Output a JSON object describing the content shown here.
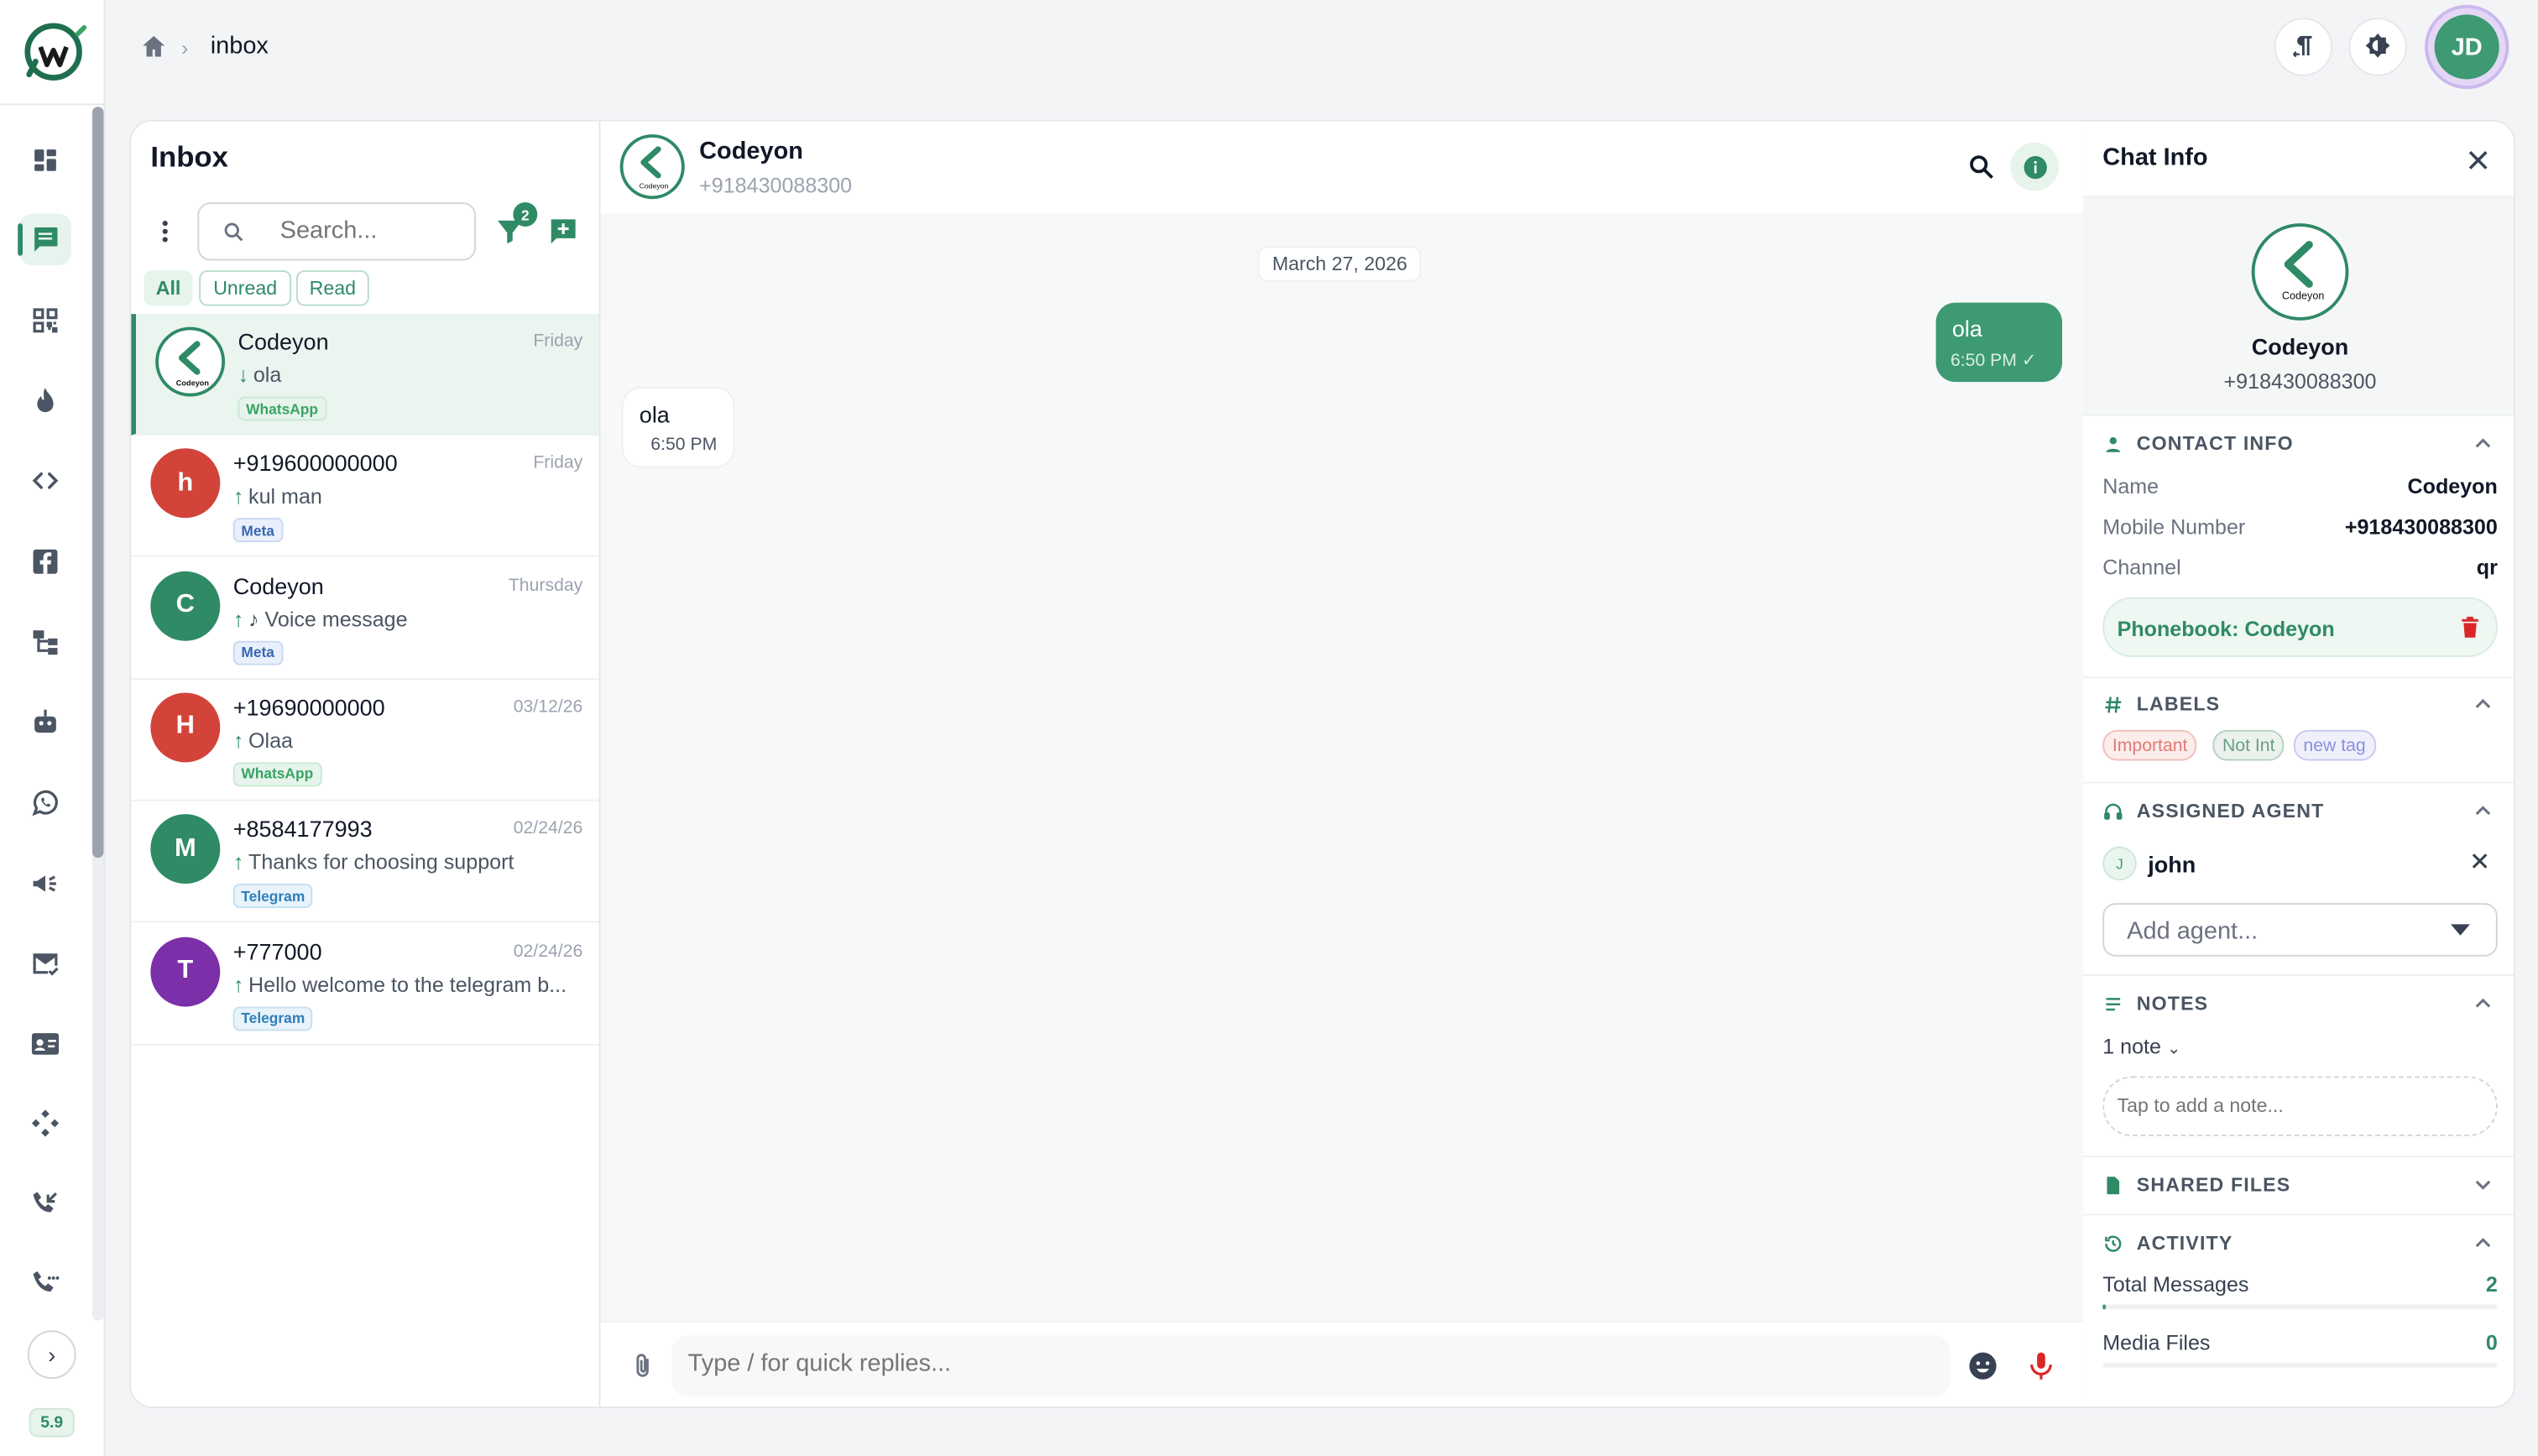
{
  "breadcrumb": {
    "current": "inbox"
  },
  "header": {
    "avatar_initials": "JD"
  },
  "sidebar": {
    "items": [
      "dashboard-icon",
      "chat-icon",
      "qr-code-icon",
      "flame-icon",
      "code-icon",
      "facebook-icon",
      "flow-icon",
      "bot-icon",
      "whatsapp-icon",
      "megaphone-icon",
      "mail-check-icon",
      "contact-card-icon",
      "integrations-icon",
      "call-incoming-icon",
      "call-log-icon"
    ],
    "active": "chat-icon",
    "version": "5.9"
  },
  "inbox": {
    "title": "Inbox",
    "search_placeholder": "Search...",
    "filter_count": "2",
    "chips": [
      "All",
      "Unread",
      "Read"
    ],
    "active_chip": "All",
    "conversations": [
      {
        "name": "Codeyon",
        "time": "Friday",
        "direction": "↓",
        "preview": "ola",
        "badge": "WhatsApp",
        "avatar": "logo"
      },
      {
        "name": "+919600000000",
        "time": "Friday",
        "direction": "↑",
        "preview": "kul man",
        "badge": "Meta",
        "avatar": "h",
        "avatar_color": "#d2433a"
      },
      {
        "name": "Codeyon",
        "time": "Thursday",
        "direction": "↑",
        "preview": "♪ Voice message",
        "badge": "Meta",
        "avatar": "C",
        "avatar_color": "#2f8a66"
      },
      {
        "name": "+19690000000",
        "time": "03/12/26",
        "direction": "↑",
        "preview": "Olaa",
        "badge": "WhatsApp",
        "avatar": "H",
        "avatar_color": "#d2433a"
      },
      {
        "name": "+8584177993",
        "time": "02/24/26",
        "direction": "↑",
        "preview": "Thanks for choosing support",
        "badge": "Telegram",
        "avatar": "M",
        "avatar_color": "#2f8a66"
      },
      {
        "name": "+777000",
        "time": "02/24/26",
        "direction": "↑",
        "preview": "Hello welcome to the telegram b...",
        "badge": "Telegram",
        "avatar": "T",
        "avatar_color": "#7b2fa8"
      }
    ]
  },
  "chat": {
    "name": "Codeyon",
    "phone": "+918430088300",
    "date": "March 27, 2026",
    "messages": [
      {
        "direction": "out",
        "text": "ola",
        "time": "6:50 PM",
        "status": "✓"
      },
      {
        "direction": "in",
        "text": "ola",
        "time": "6:50 PM"
      }
    ],
    "composer_placeholder": "Type / for quick replies..."
  },
  "info": {
    "title": "Chat Info",
    "name": "Codeyon",
    "phone": "+918430088300",
    "contact_section": "CONTACT INFO",
    "fields": [
      {
        "key": "Name",
        "value": "Codeyon"
      },
      {
        "key": "Mobile Number",
        "value": "+918430088300"
      },
      {
        "key": "Channel",
        "value": "qr"
      }
    ],
    "phonebook": "Phonebook: Codeyon",
    "labels_section": "LABELS",
    "labels": [
      {
        "text": "Important",
        "color": "#e07b72"
      },
      {
        "text": "Not Int",
        "color": "#6b9e7f"
      },
      {
        "text": "new tag",
        "color": "#8b8fe0"
      }
    ],
    "agent_section": "ASSIGNED AGENT",
    "agent_initial": "J",
    "agent_name": "john",
    "agent_placeholder": "Add agent...",
    "notes_section": "NOTES",
    "note_count": "1 note",
    "note_placeholder": "Tap to add a note...",
    "files_section": "SHARED FILES",
    "activity_section": "ACTIVITY",
    "activity": [
      {
        "label": "Total Messages",
        "value": "2",
        "fill": 0.01
      },
      {
        "label": "Media Files",
        "value": "0",
        "fill": 0
      }
    ]
  },
  "colors": {
    "brand": "#2f8a66",
    "bubble_out": "#3e9a72",
    "danger": "#dc2626"
  }
}
